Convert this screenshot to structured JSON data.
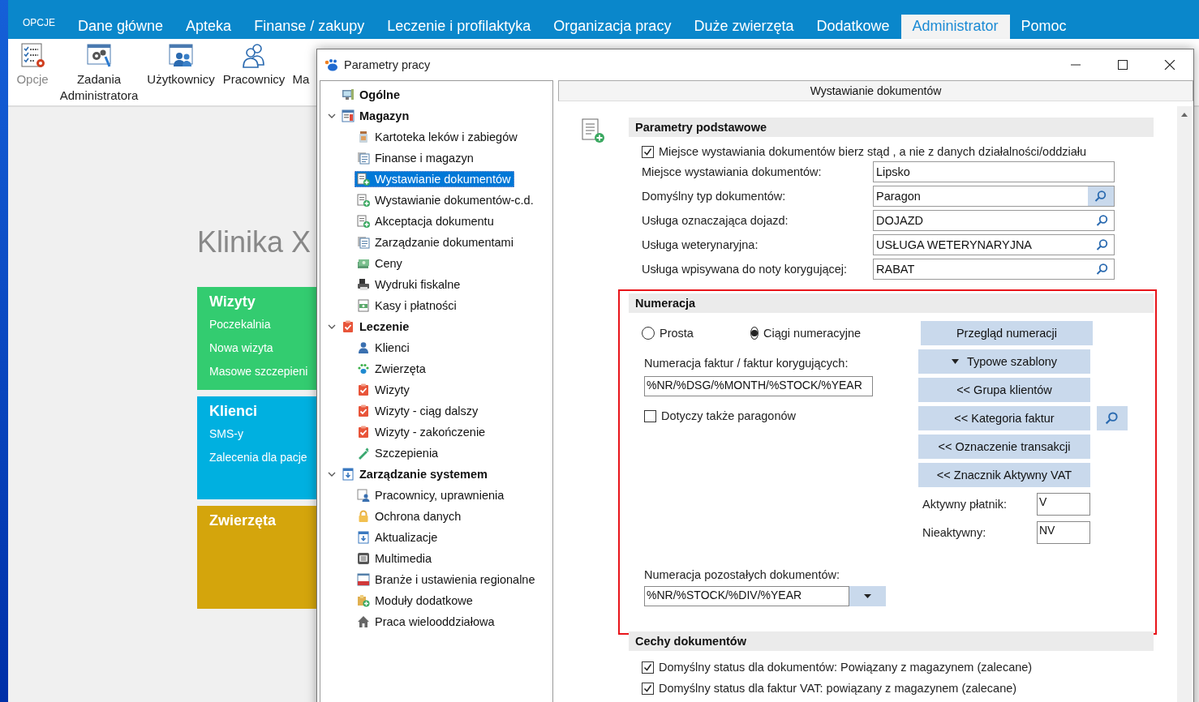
{
  "app": {
    "menu_button": "OPCJE",
    "tabs": [
      {
        "label": "Dane główne",
        "selected": false
      },
      {
        "label": "Apteka",
        "selected": false
      },
      {
        "label": "Finanse / zakupy",
        "selected": false
      },
      {
        "label": "Leczenie i profilaktyka",
        "selected": false
      },
      {
        "label": "Organizacja pracy",
        "selected": false
      },
      {
        "label": "Duże zwierzęta",
        "selected": false
      },
      {
        "label": "Dodatkowe",
        "selected": false
      },
      {
        "label": "Administrator",
        "selected": true
      },
      {
        "label": "Pomoc",
        "selected": false
      }
    ],
    "ribbon": [
      {
        "label": "Opcje",
        "disabled": true
      },
      {
        "label": "Zadania Administratora",
        "disabled": false
      },
      {
        "label": "Użytkownicy",
        "disabled": false
      },
      {
        "label": "Pracownicy",
        "disabled": false
      },
      {
        "label": "Ma",
        "disabled": false
      }
    ],
    "home": {
      "title": "Klinika X",
      "tiles": [
        {
          "title": "Wizyty",
          "color": "#33cc70",
          "links": [
            "Poczekalnia",
            "Nowa wizyta",
            "Masowe szczepieni"
          ]
        },
        {
          "title": "Klienci",
          "color": "#00b0e0",
          "links": [
            "SMS-y",
            "Zalecenia dla pacje"
          ]
        },
        {
          "title": "Zwierzęta",
          "color": "#d4a50c"
        }
      ]
    }
  },
  "dialog": {
    "title": "Parametry pracy",
    "tree": [
      {
        "label": "Ogólne",
        "selected": false
      },
      {
        "label": "Magazyn",
        "selected": false,
        "expanded": true,
        "children": [
          {
            "label": "Kartoteka leków i zabiegów",
            "selected": false
          },
          {
            "label": "Finanse i magazyn",
            "selected": false
          },
          {
            "label": "Wystawianie dokumentów",
            "selected": true
          },
          {
            "label": "Wystawianie dokumentów-c.d.",
            "selected": false
          },
          {
            "label": "Akceptacja dokumentu",
            "selected": false
          },
          {
            "label": "Zarządzanie dokumentami",
            "selected": false
          },
          {
            "label": "Ceny",
            "selected": false
          },
          {
            "label": "Wydruki fiskalne",
            "selected": false
          },
          {
            "label": "Kasy i płatności",
            "selected": false
          }
        ]
      },
      {
        "label": "Leczenie",
        "selected": false,
        "expanded": true,
        "children": [
          {
            "label": "Klienci",
            "selected": false
          },
          {
            "label": "Zwierzęta",
            "selected": false
          },
          {
            "label": "Wizyty",
            "selected": false
          },
          {
            "label": "Wizyty - ciąg dalszy",
            "selected": false
          },
          {
            "label": "Wizyty - zakończenie",
            "selected": false
          },
          {
            "label": "Szczepienia",
            "selected": false
          }
        ]
      },
      {
        "label": "Zarządzanie systemem",
        "selected": false,
        "expanded": true,
        "children": [
          {
            "label": "Pracownicy, uprawnienia",
            "selected": false
          },
          {
            "label": "Ochrona danych",
            "selected": false
          },
          {
            "label": "Aktualizacje",
            "selected": false
          },
          {
            "label": "Multimedia",
            "selected": false
          },
          {
            "label": "Branże i ustawienia regionalne",
            "selected": false
          },
          {
            "label": "Moduły dodatkowe",
            "selected": false
          },
          {
            "label": "Praca wielooddziałowa",
            "selected": false
          }
        ]
      }
    ],
    "panel": {
      "header": "Wystawianie dokumentów",
      "basic": {
        "title": "Parametry podstawowe",
        "checkbox": {
          "label": "Miejsce wystawiania dokumentów bierz stąd , a nie z danych działalności/oddziału",
          "checked": true
        },
        "fields": [
          {
            "label": "Miejsce wystawiania dokumentów:",
            "value": "Lipsko",
            "kind": "text"
          },
          {
            "label": "Domyślny typ dokumentów:",
            "value": "Paragon",
            "kind": "picker"
          },
          {
            "label": "Usługa oznaczająca dojazd:",
            "value": "DOJAZD",
            "kind": "lookup"
          },
          {
            "label": "Usługa weterynaryjna:",
            "value": "USŁUGA WETERYNARYJNA",
            "kind": "lookup"
          },
          {
            "label": "Usługa wpisywana do noty korygującej:",
            "value": "RABAT",
            "kind": "lookup"
          }
        ]
      },
      "numbering": {
        "title": "Numeracja",
        "highlighted": true,
        "radios": [
          {
            "label": "Prosta",
            "selected": false
          },
          {
            "label": "Ciągi numeracyjne",
            "selected": true
          }
        ],
        "invoice_label": "Numeracja faktur / faktur korygujących:",
        "invoice_value": "%NR/%DSG/%MONTH/%STOCK/%YEAR",
        "checkbox": {
          "label": "Dotyczy także paragonów",
          "checked": false
        },
        "buttons": [
          {
            "label": "Przegląd numeracji",
            "kind": "plain"
          },
          {
            "label": "Typowe szablony",
            "kind": "menu"
          },
          {
            "label": "<< Grupa klientów",
            "kind": "plain"
          },
          {
            "label": "<< Kategoria faktur",
            "kind": "lookup"
          },
          {
            "label": "<< Oznaczenie transakcji",
            "kind": "plain"
          },
          {
            "label": "<< Znacznik Aktywny VAT",
            "kind": "plain"
          }
        ],
        "vat_fields": [
          {
            "label": "Aktywny płatnik:",
            "value": "V"
          },
          {
            "label": "Nieaktywny:",
            "value": "NV"
          }
        ],
        "other_label": "Numeracja pozostałych dokumentów:",
        "other_value": "%NR/%STOCK/%DIV/%YEAR"
      },
      "features": {
        "title": "Cechy dokumentów",
        "checkboxes": [
          {
            "label": "Domyślny status dla dokumentów: Powiązany z magazynem (zalecane)",
            "checked": true
          },
          {
            "label": "Domyślny status dla faktur VAT: powiązany z magazynem (zalecane)",
            "checked": true
          }
        ]
      }
    }
  }
}
